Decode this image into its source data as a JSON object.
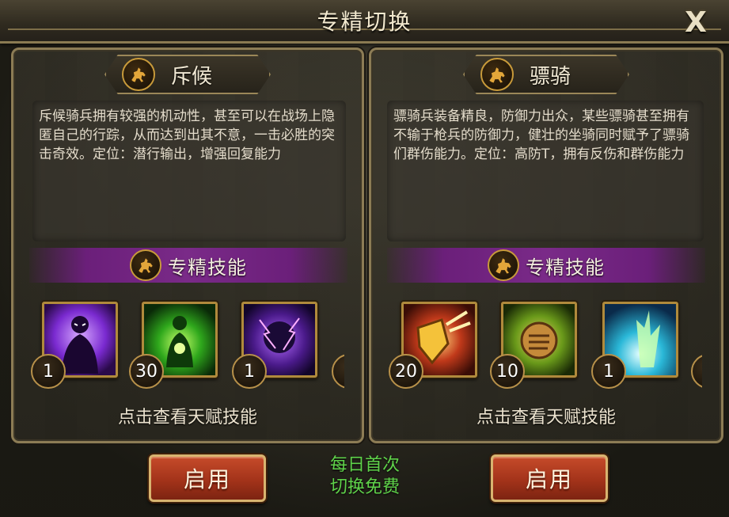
{
  "window": {
    "title": "专精切换",
    "close_label": "X"
  },
  "left_panel": {
    "name": "斥候",
    "emblem_icon": "horse-rider-icon",
    "description": "斥候骑兵拥有较强的机动性，甚至可以在战场上隐匿自己的行踪，从而达到出其不意，一击必胜的突击奇效。定位：潜行输出，增强回复能力",
    "skill_header": "专精技能",
    "skills": [
      {
        "icon": "shadow-figure-icon",
        "level": "1"
      },
      {
        "icon": "green-aura-figure-icon",
        "level": "30"
      },
      {
        "icon": "purple-lightning-figure-icon",
        "level": "1"
      }
    ],
    "hint": "点击查看天赋技能",
    "action_label": "启用"
  },
  "right_panel": {
    "name": "骠骑",
    "emblem_icon": "horse-rider-icon",
    "description": "骠骑兵装备精良，防御力出众，某些骠骑甚至拥有不输于枪兵的防御力，健壮的坐骑同时赋予了骠骑们群伤能力。定位：高防T，拥有反伤和群伤能力",
    "skill_header": "专精技能",
    "skills": [
      {
        "icon": "golden-shield-icon",
        "level": "20"
      },
      {
        "icon": "fist-strike-icon",
        "level": "10"
      },
      {
        "icon": "ice-burst-icon",
        "level": "1"
      }
    ],
    "hint": "点击查看天赋技能",
    "action_label": "启用"
  },
  "free_notice": [
    "每日首次",
    "切换免费"
  ],
  "colors": {
    "accent_gold": "#b08a3c",
    "skill_bar_purple": "#7a2a88",
    "button_red": "#a3331a",
    "free_green": "#5fd24a"
  }
}
